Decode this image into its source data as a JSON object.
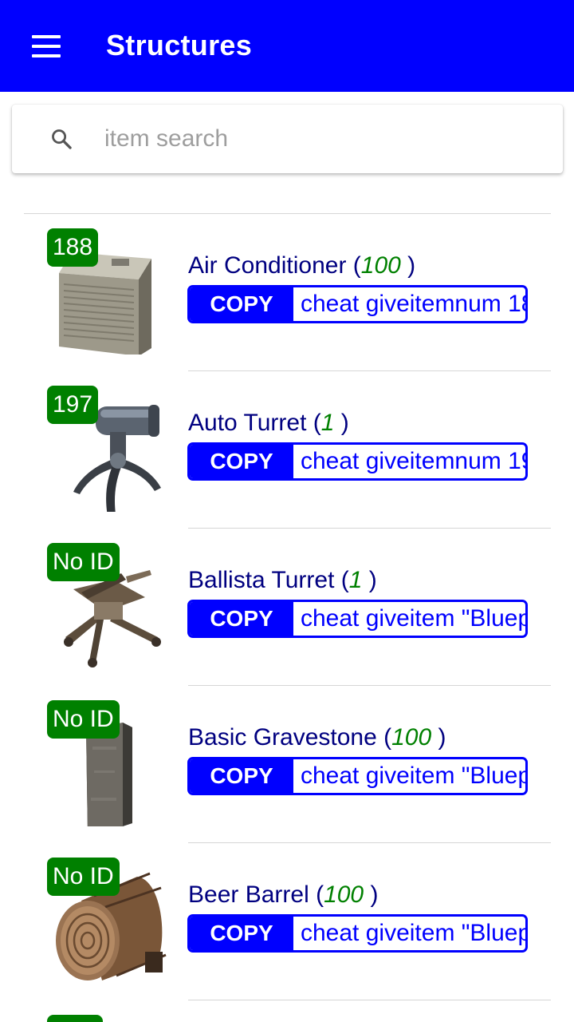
{
  "appbar": {
    "title": "Structures",
    "menu_icon": "hamburger-menu-icon"
  },
  "search": {
    "placeholder": "item search",
    "value": "",
    "icon": "search-icon"
  },
  "colors": {
    "primary": "#0000ff",
    "badge": "#008000",
    "name_text": "#000080",
    "quantity": "#008000"
  },
  "items": [
    {
      "badge": "188",
      "name": "Air Conditioner",
      "qty_open": " (",
      "quantity": "100",
      "qty_close": " )",
      "copy_label": "COPY",
      "command": "cheat giveitemnum 18",
      "image": "air-conditioner-image"
    },
    {
      "badge": "197",
      "name": "Auto Turret",
      "qty_open": " (",
      "quantity": "1",
      "qty_close": " )",
      "copy_label": "COPY",
      "command": "cheat giveitemnum 19",
      "image": "auto-turret-image"
    },
    {
      "badge": "No ID",
      "name": "Ballista Turret",
      "qty_open": " (",
      "quantity": "1",
      "qty_close": " )",
      "copy_label": "COPY",
      "command": "cheat giveitem \"Bluep",
      "image": "ballista-turret-image"
    },
    {
      "badge": "No ID",
      "name": "Basic Gravestone",
      "qty_open": " (",
      "quantity": "100",
      "qty_close": " )",
      "copy_label": "COPY",
      "command": "cheat giveitem \"Bluep",
      "image": "gravestone-image"
    },
    {
      "badge": "No ID",
      "name": "Beer Barrel",
      "qty_open": " (",
      "quantity": "100",
      "qty_close": " )",
      "copy_label": "COPY",
      "command": "cheat giveitem \"Bluep",
      "image": "beer-barrel-image"
    }
  ]
}
